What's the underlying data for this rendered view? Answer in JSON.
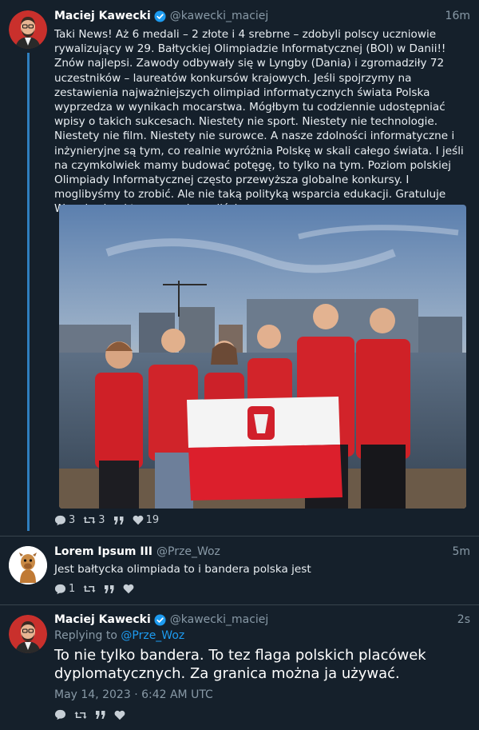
{
  "thread": {
    "tweets": [
      {
        "author": "Maciej Kawecki",
        "handle": "@kawecki_maciej",
        "time": "16m",
        "text": "Taki News! Aż 6 medali – 2 złote i 4 srebrne – zdobyli polscy uczniowie rywalizujący w 29. Bałtyckiej Olimpiadzie Informatycznej (BOI) w Danii!! Znów najlepsi. Zawody odbywały się w Lyngby (Dania) i zgromadziły 72 uczestników – laureatów konkursów krajowych. Jeśli spojrzymy na zestawienia najważniejszych olimpiad informatycznych świata Polska wyprzedza w wynikach mocarstwa. Mógłbym tu codziennie udostępniać wpisy o takich sukcesach. Niestety nie sport. Niestety nie technologie. Niestety nie film. Niestety nie surowce. A nasze zdolności informatyczne i inżynieryjne są tym, co realnie wyróżnia Polskę w skali całego świata. I jeśli na czymkolwiek mamy budować potęgę, to tylko na tym. Poziom polskiej Olimpiady Informatycznej często przewyższa globalne konkursy. I moglibyśmy to zrobić. Ale nie taką polityką wsparcia edukacji. Gratuluje Wam kochani tego co osiągnęliście.",
        "counts": {
          "replies": "3",
          "retweets": "3",
          "likes": "19"
        }
      },
      {
        "author": "Lorem Ipsum III",
        "handle": "@Prze_Woz",
        "time": "5m",
        "text": "Jest bałtycka olimpiada to i bandera polska jest",
        "counts": {
          "replies": "1"
        }
      },
      {
        "author": "Maciej Kawecki",
        "handle": "@kawecki_maciej",
        "time": "2s",
        "replying_prefix": "Replying to",
        "replying_to": "@Prze_Woz",
        "text": "To nie tylko bandera. To tez flaga polskich placówek dyplomatycznych. Za granica można ja używać.",
        "date": "May 14, 2023 · 6:42 AM UTC"
      }
    ]
  },
  "colors": {
    "background": "#15202b",
    "thread_line": "#2f7fbf",
    "link": "#1d9bf0",
    "muted": "#8899a6",
    "verified": "#1d9bf0"
  },
  "icons": [
    "reply-icon",
    "retweet-icon",
    "quote-icon",
    "like-icon",
    "verified-badge-icon"
  ]
}
